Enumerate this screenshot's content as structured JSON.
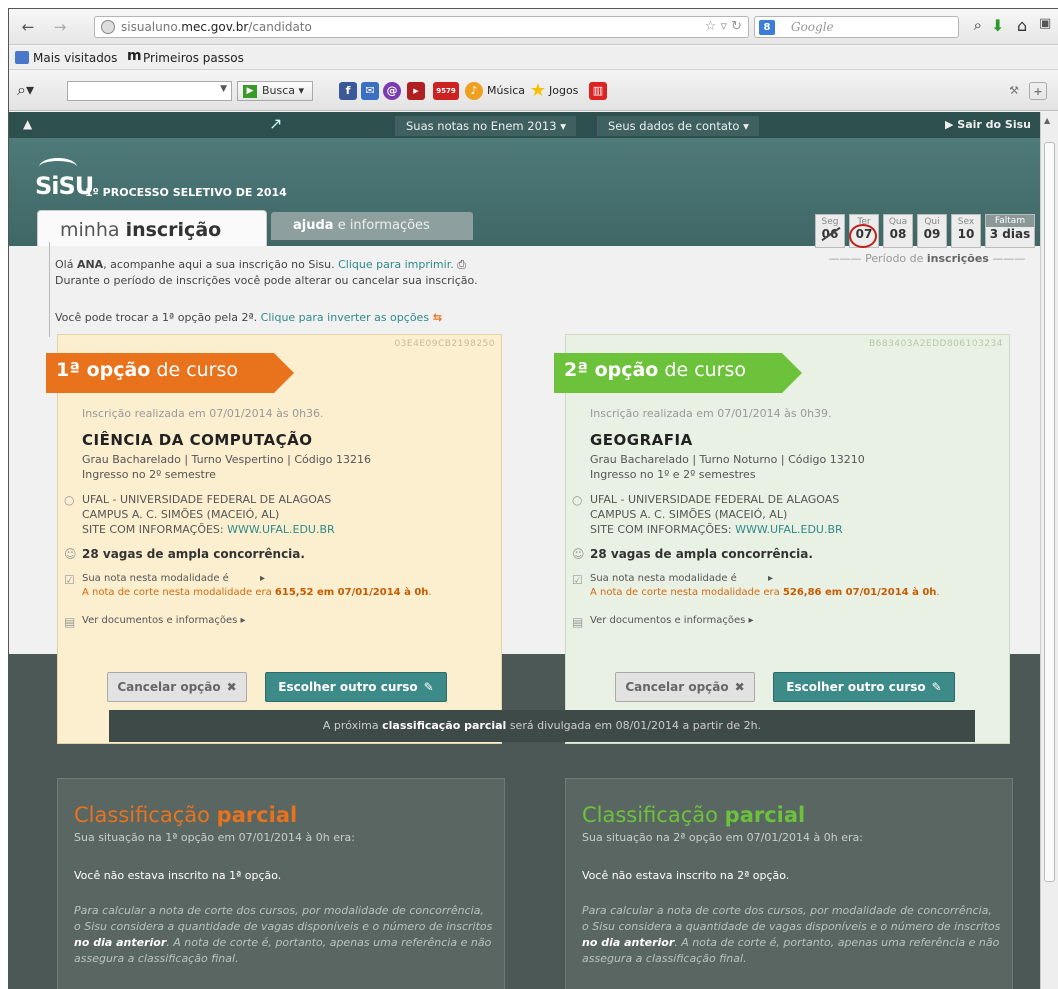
{
  "browser": {
    "url_prefix": "sisualuno.",
    "url_host": "mec.gov.br",
    "url_path": "/candidato",
    "search_placeholder": "Google",
    "search_badge": "8",
    "bookmarks": [
      "Mais visitados",
      "Primeiros passos"
    ],
    "toolbar_search_btn": "Busca",
    "toolbar_items": [
      "Música",
      "Jogos"
    ],
    "toolbar_badge": "9579"
  },
  "topbar": {
    "menu_notas": "Suas notas no Enem 2013",
    "menu_contato": "Seus dados de contato",
    "sair": "Sair do Sisu"
  },
  "header": {
    "logo": "SiSU",
    "title": "1º PROCESSO SELETIVO DE 2014",
    "tab_minha_1": "minha ",
    "tab_minha_2": "inscrição",
    "tab_ajuda_1": "ajuda",
    "tab_ajuda_2": " e informações"
  },
  "calendar": {
    "days": [
      {
        "name": "Seg",
        "num": "06"
      },
      {
        "name": "Ter",
        "num": "07"
      },
      {
        "name": "Qua",
        "num": "08"
      },
      {
        "name": "Qui",
        "num": "09"
      },
      {
        "name": "Sex",
        "num": "10"
      }
    ],
    "faltam_label": "Faltam",
    "faltam_value": "3 dias",
    "periodo_1": "Período de ",
    "periodo_2": "inscrições"
  },
  "intro": {
    "hello_1": "Olá ",
    "name": "ANA",
    "hello_2": ", acompanhe aqui a sua inscrição no Sisu. ",
    "print_link": "Clique para imprimir.",
    "line2": "Durante o período de inscrições você pode alterar ou cancelar sua inscrição.",
    "swap_1": "Você pode trocar a 1ª opção pela 2ª. ",
    "swap_link": "Clique para inverter as opções"
  },
  "option1": {
    "code": "03E4E09CB2198250",
    "badge_1": "1ª ",
    "badge_2": "opção",
    "badge_3": " de curso",
    "inscricao": "Inscrição realizada em 07/01/2014 às 0h36.",
    "course": "CIÊNCIA DA COMPUTAÇÃO",
    "grau": "Grau Bacharelado | Turno Vespertino | Código 13216",
    "ingresso": "Ingresso no 2º semestre",
    "univ": "UFAL - UNIVERSIDADE FEDERAL DE ALAGOAS",
    "campus": "CAMPUS A. C. SIMÕES (MACEIÓ, AL)",
    "site_label": "SITE COM INFORMAÇÕES: ",
    "site": "WWW.UFAL.EDU.BR",
    "vagas": "28 vagas de ampla concorrência.",
    "nota_link": "Sua nota nesta modalidade é",
    "corte_1": "A nota de corte nesta modalidade era ",
    "corte_2": "615,52 em 07/01/2014 à 0h",
    "corte_3": ".",
    "docs": "Ver documentos e informações",
    "cancel": "Cancelar opção",
    "choose": "Escolher outro curso"
  },
  "option2": {
    "code": "B683403A2EDD806103234",
    "badge_1": "2ª ",
    "badge_2": "opção",
    "badge_3": " de curso",
    "inscricao": "Inscrição realizada em 07/01/2014 às 0h39.",
    "course": "GEOGRAFIA",
    "grau": "Grau Bacharelado | Turno Noturno | Código 13210",
    "ingresso": "Ingresso no 1º e 2º semestres",
    "univ": "UFAL - UNIVERSIDADE FEDERAL DE ALAGOAS",
    "campus": "CAMPUS A. C. SIMÕES (MACEIÓ, AL)",
    "site_label": "SITE COM INFORMAÇÕES: ",
    "site": "WWW.UFAL.EDU.BR",
    "vagas": "28 vagas de ampla concorrência.",
    "nota_link": "Sua nota nesta modalidade é",
    "corte_1": "A nota de corte nesta modalidade era ",
    "corte_2": "526,86 em 07/01/2014 à 0h",
    "corte_3": ".",
    "docs": "Ver documentos e informações",
    "cancel": "Cancelar opção",
    "choose": "Escolher outro curso"
  },
  "proxima": {
    "t1": "A próxima ",
    "t2": "classificação parcial",
    "t3": " será divulgada em 08/01/2014 a partir de 2h."
  },
  "classificacao1": {
    "title_1": "Classificação ",
    "title_2": "parcial",
    "sub": "Sua situação na 1ª opção em 07/01/2014 à 0h era:",
    "status": "Você não estava inscrito na 1ª opção.",
    "body_1": "Para calcular a nota de corte dos cursos, por modalidade de concorrência, o Sisu considera a quantidade de vagas disponíveis e o número de inscritos ",
    "body_2": "no dia anterior",
    "body_3": ". A nota de corte é, portanto, apenas uma referência e não assegura a classificação final."
  },
  "classificacao2": {
    "title_1": "Classificação ",
    "title_2": "parcial",
    "sub": "Sua situação na 2ª opção em 07/01/2014 à 0h era:",
    "status": "Você não estava inscrito na 2ª opção.",
    "body_1": "Para calcular a nota de corte dos cursos, por modalidade de concorrência, o Sisu considera a quantidade de vagas disponíveis e o número de inscritos ",
    "body_2": "no dia anterior",
    "body_3": ". A nota de corte é, portanto, apenas uma referência e não assegura a classificação final."
  },
  "colors": {
    "orange": "#e8731c",
    "green": "#6cc23a",
    "teal": "#3d8b88"
  }
}
